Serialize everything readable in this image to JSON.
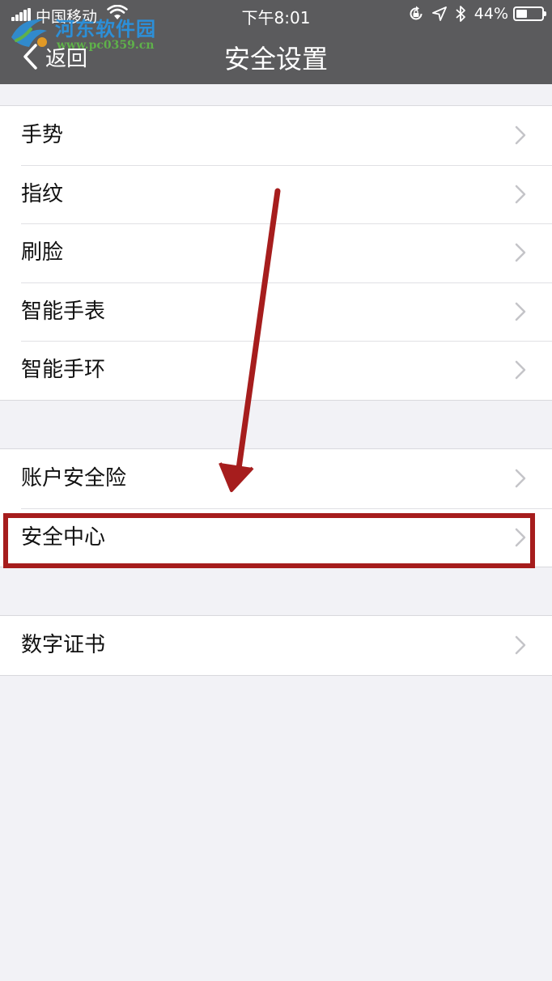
{
  "status_bar": {
    "carrier": "中国移动",
    "time": "下午8:01",
    "battery_percent": "44%",
    "battery_level": 0.44
  },
  "watermark": {
    "title": "河东软件园",
    "url": "www.pc0359.cn"
  },
  "nav": {
    "back_label": "返回",
    "title": "安全设置"
  },
  "groups": [
    {
      "items": [
        {
          "label": "手势"
        },
        {
          "label": "指纹"
        },
        {
          "label": "刷脸"
        },
        {
          "label": "智能手表"
        },
        {
          "label": "智能手环"
        }
      ]
    },
    {
      "items": [
        {
          "label": "账户安全险"
        },
        {
          "label": "安全中心"
        }
      ]
    },
    {
      "items": [
        {
          "label": "数字证书"
        }
      ]
    }
  ],
  "annotation": {
    "highlighted_item": "安全中心",
    "color": "#a61d1d"
  },
  "colors": {
    "nav_background": "#5b5b5d",
    "page_background": "#f2f2f6"
  }
}
